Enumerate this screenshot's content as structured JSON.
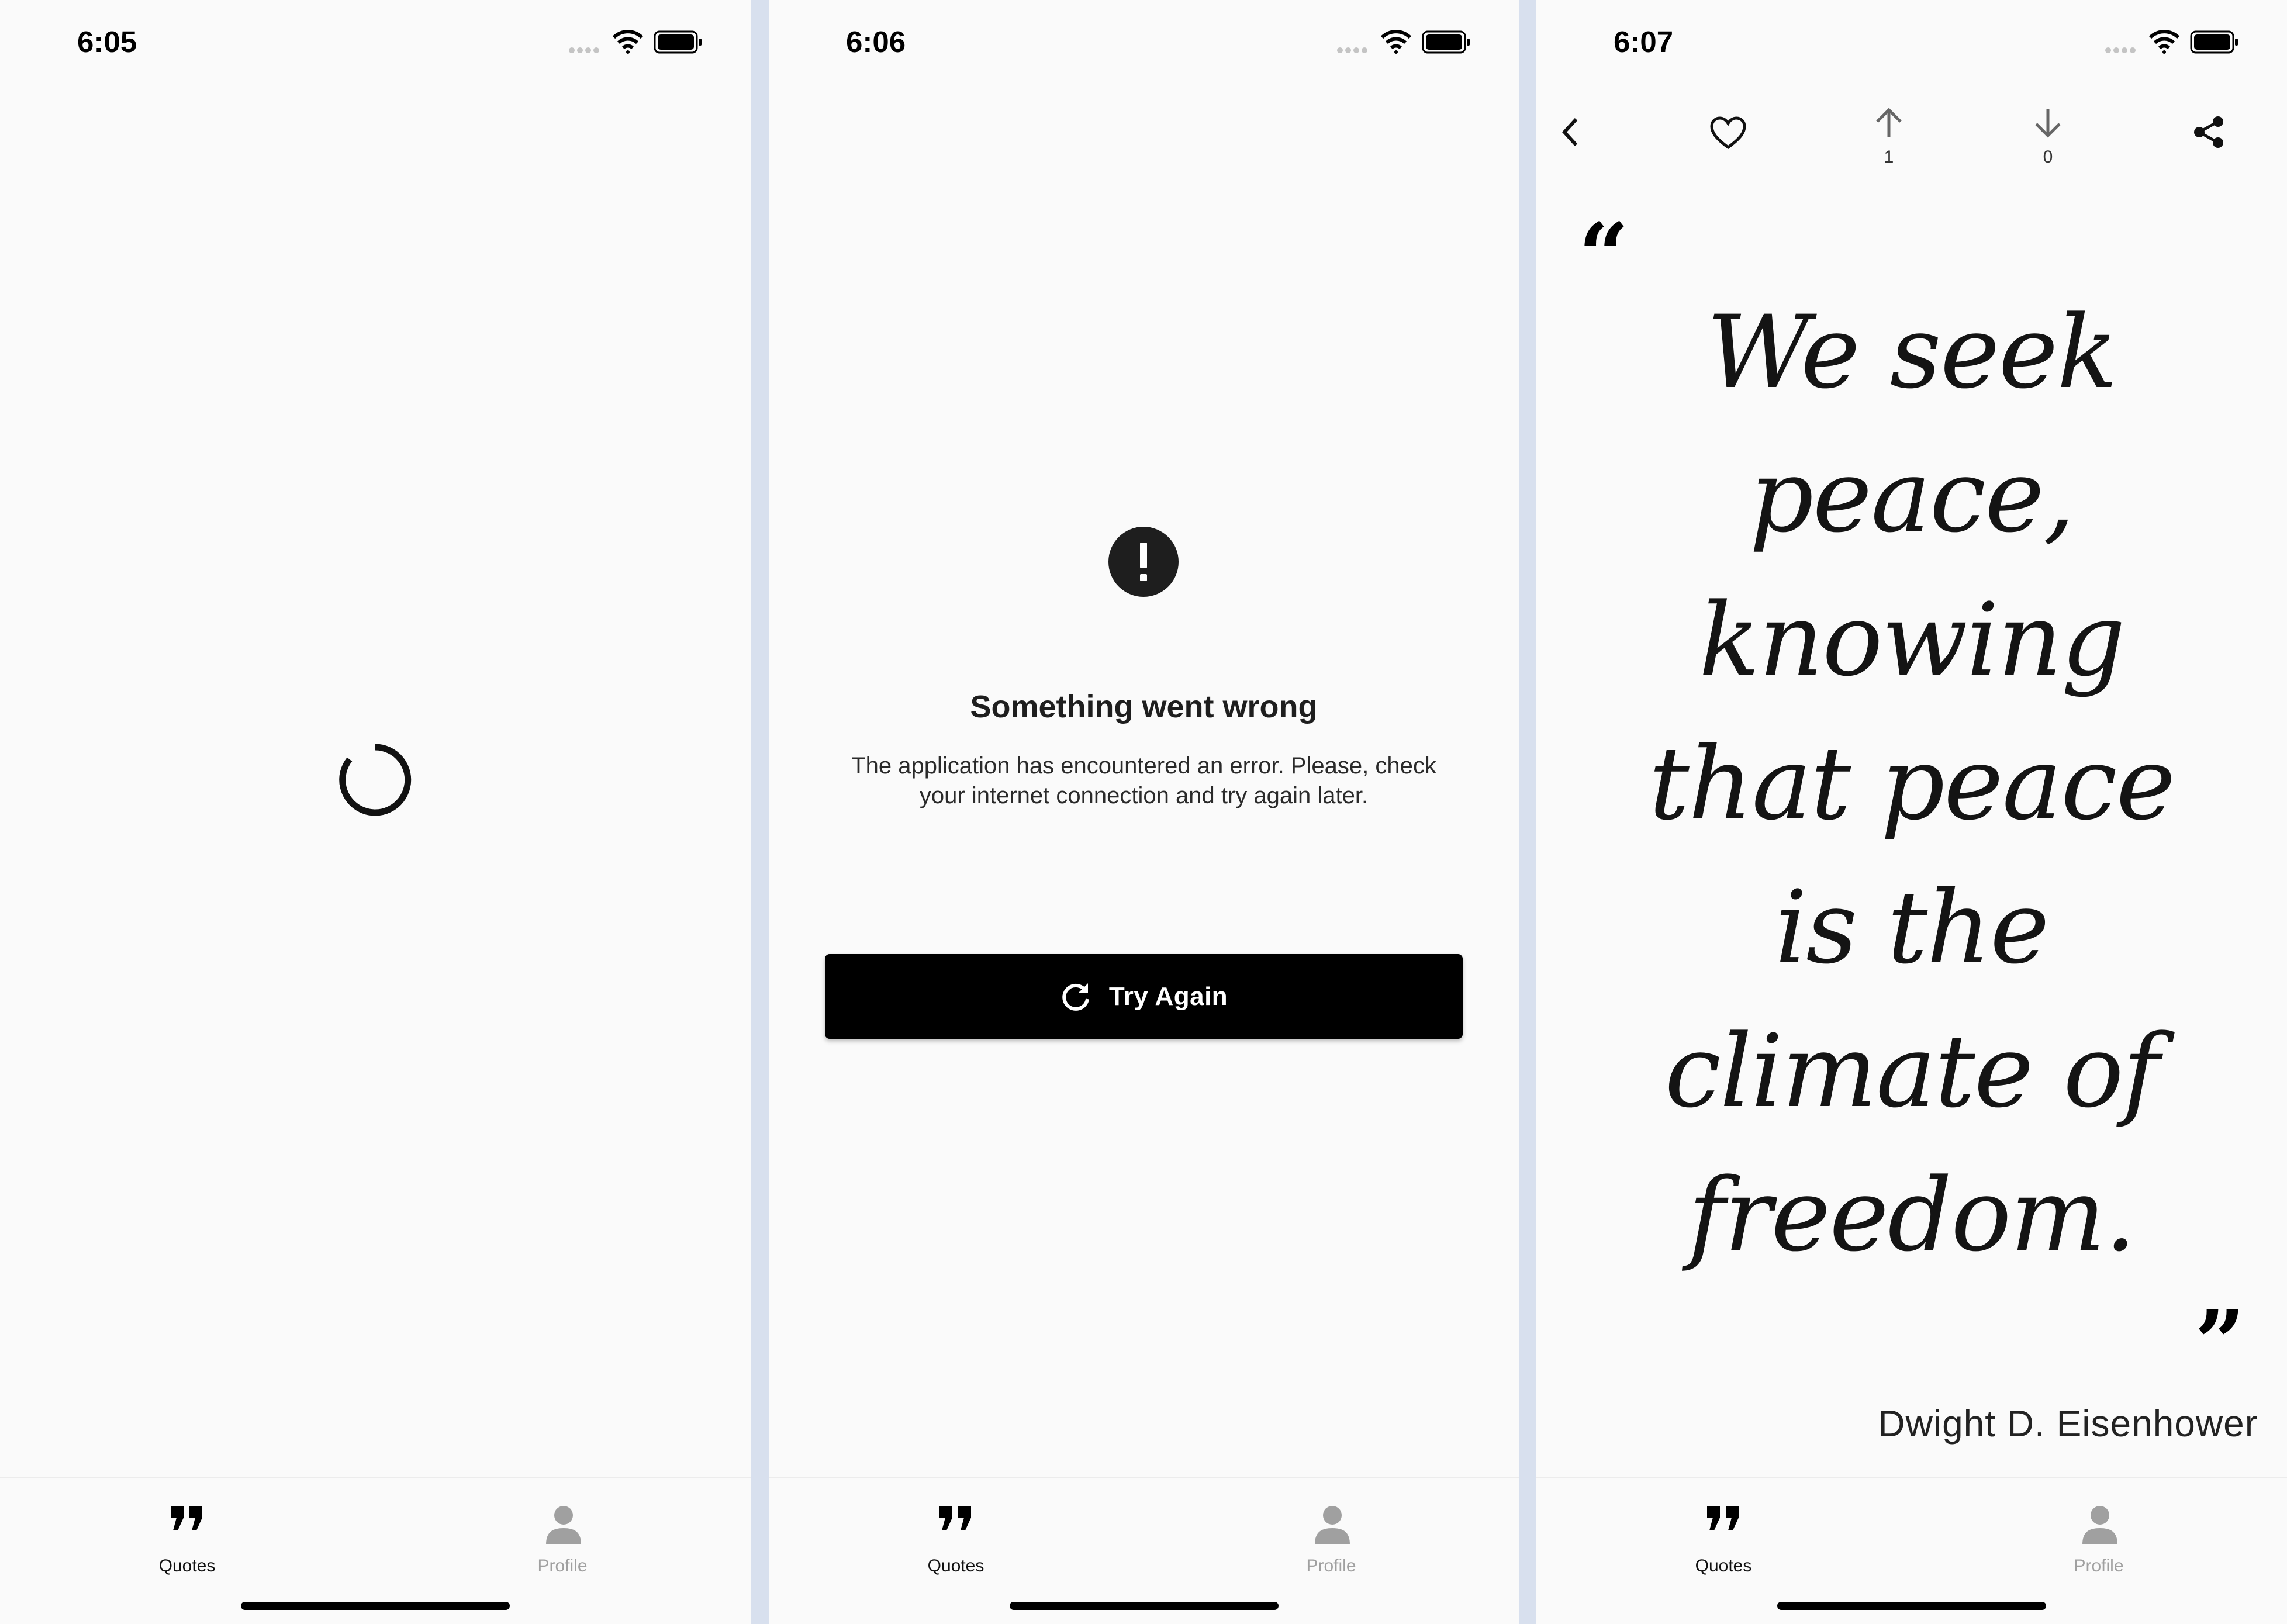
{
  "screens": [
    {
      "status_time": "6:05"
    },
    {
      "status_time": "6:06"
    },
    {
      "status_time": "6:07"
    }
  ],
  "tabs": {
    "quotes": "Quotes",
    "profile": "Profile"
  },
  "error": {
    "title": "Something went wrong",
    "message": "The application has encountered an error. Please, check your internet connection and try again later.",
    "retry_label": "Try Again"
  },
  "quote": {
    "text": "We seek peace, knowing that peace is the climate of freedom.",
    "author": "Dwight D. Eisenhower",
    "upvotes": "1",
    "downvotes": "0"
  },
  "icons": {
    "quotes_tab": "format-quote-icon",
    "profile_tab": "person-icon",
    "error": "exclamation-circle-icon",
    "retry": "refresh-icon",
    "back": "chevron-left-icon",
    "favorite": "heart-outline-icon",
    "upvote": "arrow-up-icon",
    "downvote": "arrow-down-icon",
    "share": "share-icon"
  },
  "colors": {
    "background": "#fafafa",
    "primary": "#000000",
    "inactive": "#a0a0a0",
    "divider": "#d8e0ee"
  }
}
